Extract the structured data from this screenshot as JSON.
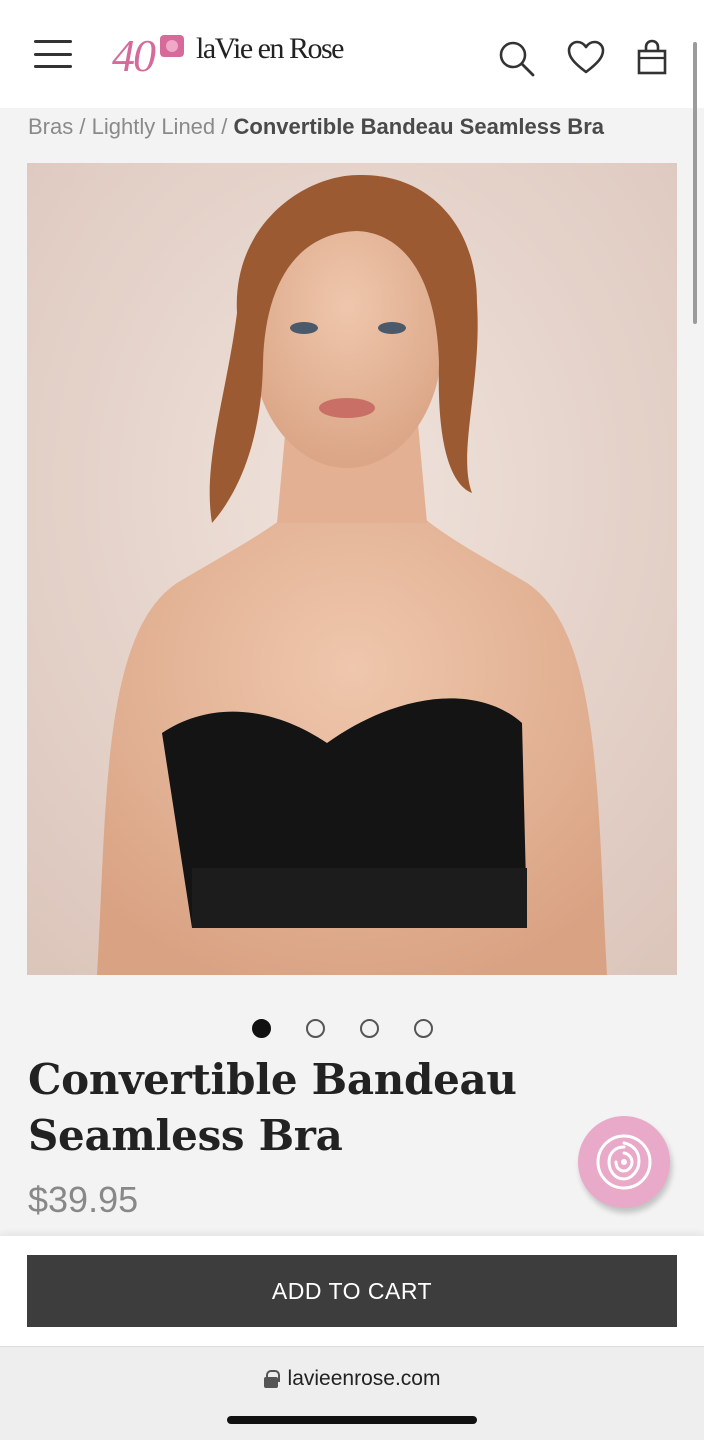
{
  "header": {
    "logo_anniversary": "40",
    "logo_text": "laVie en Rose",
    "icons": [
      "menu-icon",
      "search-icon",
      "heart-icon",
      "bag-icon"
    ]
  },
  "breadcrumb": {
    "items": [
      "Bras",
      "Lightly Lined"
    ],
    "current": "Convertible Bandeau Seamless Bra"
  },
  "gallery": {
    "image_count": 4,
    "active_index": 0
  },
  "product": {
    "title": "Convertible Bandeau Seamless Bra",
    "price": "$39.95"
  },
  "cart": {
    "button_label": "ADD TO CART"
  },
  "browser": {
    "url": "lavieenrose.com"
  },
  "colors": {
    "brand_pink": "#d66a9a",
    "cart_button": "#3d3d3d",
    "chat_bubble": "#e9a9c8"
  }
}
